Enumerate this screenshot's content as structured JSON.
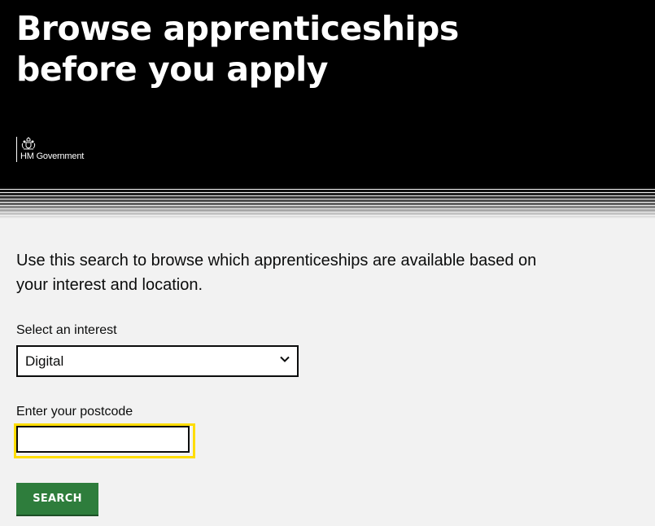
{
  "hero": {
    "title": "Browse apprenticeships before you apply",
    "brand_text": "HM Government",
    "crest_icon": "royal-coat-of-arms-icon"
  },
  "main": {
    "intro": "Use this search to browse which apprenticeships are available based on your interest and location.",
    "interest": {
      "label": "Select an interest",
      "selected": "Digital",
      "icon": "chevron-down-icon"
    },
    "postcode": {
      "label": "Enter your postcode",
      "value": "",
      "placeholder": ""
    },
    "search_button": "SEARCH"
  },
  "colors": {
    "hero_bg": "#000000",
    "page_bg": "#f2f2f2",
    "focus": "#ffdd00",
    "button": "#2e7d3c"
  }
}
